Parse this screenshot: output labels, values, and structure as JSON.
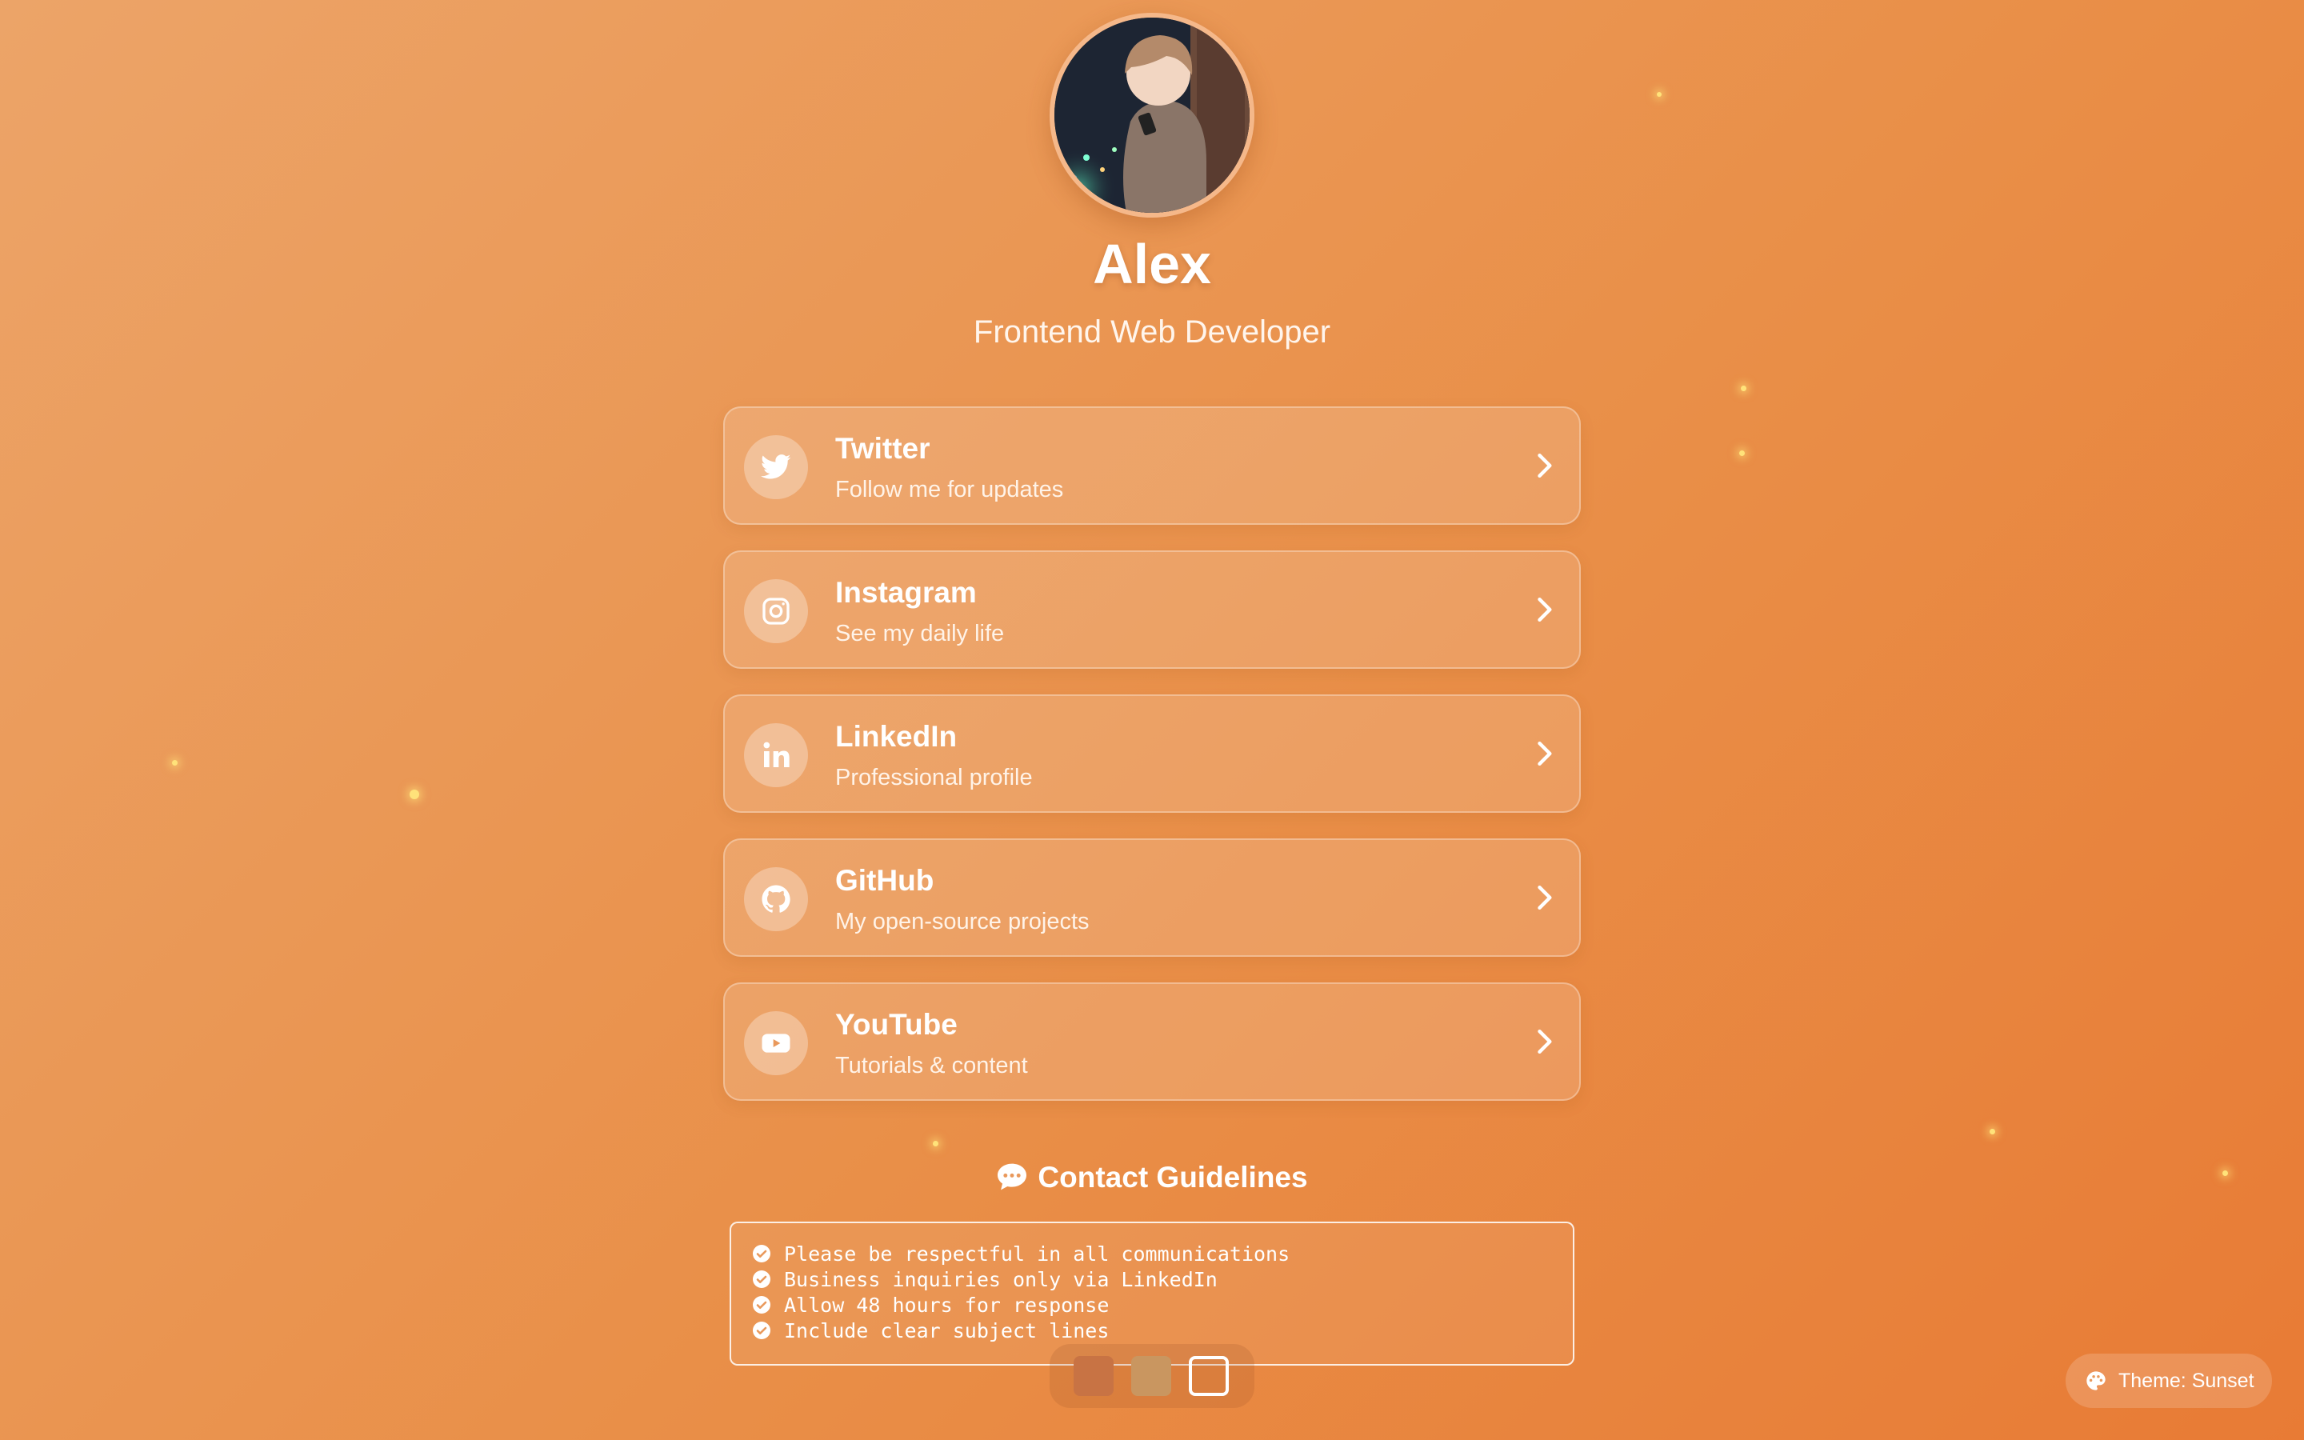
{
  "profile": {
    "name": "Alex",
    "role": "Frontend Web Developer"
  },
  "links": [
    {
      "icon": "twitter-icon",
      "title": "Twitter",
      "desc": "Follow me for updates"
    },
    {
      "icon": "instagram-icon",
      "title": "Instagram",
      "desc": "See my daily life"
    },
    {
      "icon": "linkedin-icon",
      "title": "LinkedIn",
      "desc": "Professional profile"
    },
    {
      "icon": "github-icon",
      "title": "GitHub",
      "desc": "My open-source projects"
    },
    {
      "icon": "youtube-icon",
      "title": "YouTube",
      "desc": "Tutorials & content"
    }
  ],
  "guidelines": {
    "title": "Contact Guidelines",
    "items": [
      "Please be respectful in all communications",
      "Business inquiries only via LinkedIn",
      "Allow 48 hours for response",
      "Include clear subject lines"
    ]
  },
  "theme": {
    "label": "Theme: Sunset",
    "swatch_colors": [
      "#c87344",
      "#c99660",
      "transparent"
    ]
  },
  "colors": {
    "background_start": "#eca468",
    "background_end": "#e87b35",
    "accent": "#ffffff"
  }
}
